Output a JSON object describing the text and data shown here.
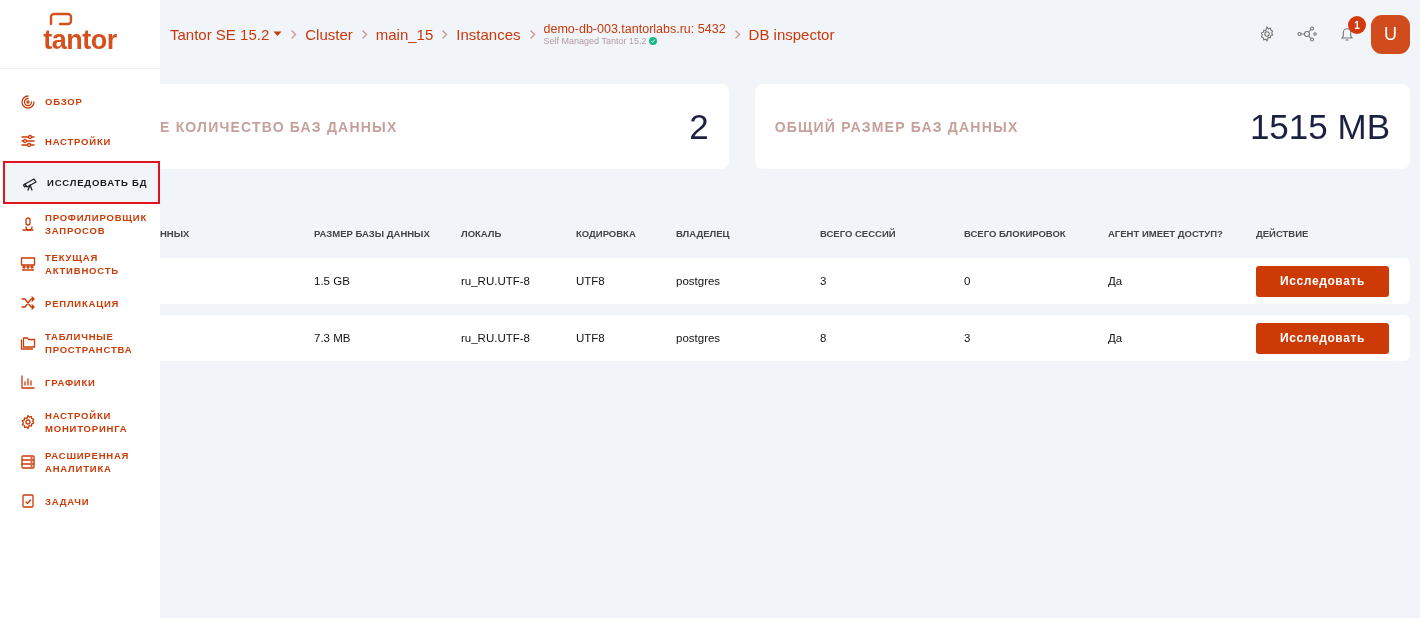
{
  "logo": {
    "text": "tantor"
  },
  "breadcrumbs": [
    {
      "label": "Tantor SE 15.2",
      "kind": "dropdown"
    },
    {
      "label": "Cluster",
      "kind": "link"
    },
    {
      "label": "main_15",
      "kind": "link"
    },
    {
      "label": "Instances",
      "kind": "link"
    },
    {
      "label": "demo-db-003.tantorlabs.ru: 5432",
      "subtitle": "Self Managed Tantor 15.2",
      "verified": true,
      "kind": "instance"
    },
    {
      "label": "DB inspector",
      "kind": "link"
    }
  ],
  "header_actions": {
    "notification_count": "1",
    "avatar": "U"
  },
  "sidebar": {
    "items": [
      {
        "label": "ОБЗОР",
        "selected": false
      },
      {
        "label": "НАСТРОЙКИ",
        "selected": false
      },
      {
        "label": "ИССЛЕДОВАТЬ БД",
        "selected": true
      },
      {
        "label": "ПРОФИЛИРОВЩИК ЗАПРОСОВ",
        "selected": false
      },
      {
        "label": "ТЕКУЩАЯ АКТИВНОСТЬ",
        "selected": false
      },
      {
        "label": "РЕПЛИКАЦИЯ",
        "selected": false
      },
      {
        "label": "ТАБЛИЧНЫЕ ПРОСТРАНСТВА",
        "selected": false
      },
      {
        "label": "ГРАФИКИ",
        "selected": false
      },
      {
        "label": "НАСТРОЙКИ МОНИТОРИНГА",
        "selected": false
      },
      {
        "label": "РАСШИРЕННАЯ АНАЛИТИКА",
        "selected": false
      },
      {
        "label": "ЗАДАЧИ",
        "selected": false
      }
    ]
  },
  "stats": [
    {
      "label": "Е КОЛИЧЕСТВО БАЗ ДАННЫХ",
      "value": "2"
    },
    {
      "label": "ОБЩИЙ РАЗМЕР БАЗ ДАННЫХ",
      "value": "1515 MB"
    }
  ],
  "table": {
    "columns": [
      "ННЫХ",
      "РАЗМЕР БАЗЫ ДАННЫХ",
      "ЛОКАЛЬ",
      "КОДИРОВКА",
      "ВЛАДЕЛЕЦ",
      "ВСЕГО СЕССИЙ",
      "ВСЕГО БЛОКИРОВОК",
      "АГЕНТ ИМЕЕТ ДОСТУП?",
      "ДЕЙСТВИЕ"
    ],
    "rows": [
      {
        "cells": [
          "",
          "1.5 GB",
          "ru_RU.UTF-8",
          "UTF8",
          "postgres",
          "3",
          "0",
          "Да"
        ],
        "action": "Исследовать"
      },
      {
        "cells": [
          "",
          "7.3 MB",
          "ru_RU.UTF-8",
          "UTF8",
          "postgres",
          "8",
          "3",
          "Да"
        ],
        "action": "Исследовать"
      }
    ]
  }
}
